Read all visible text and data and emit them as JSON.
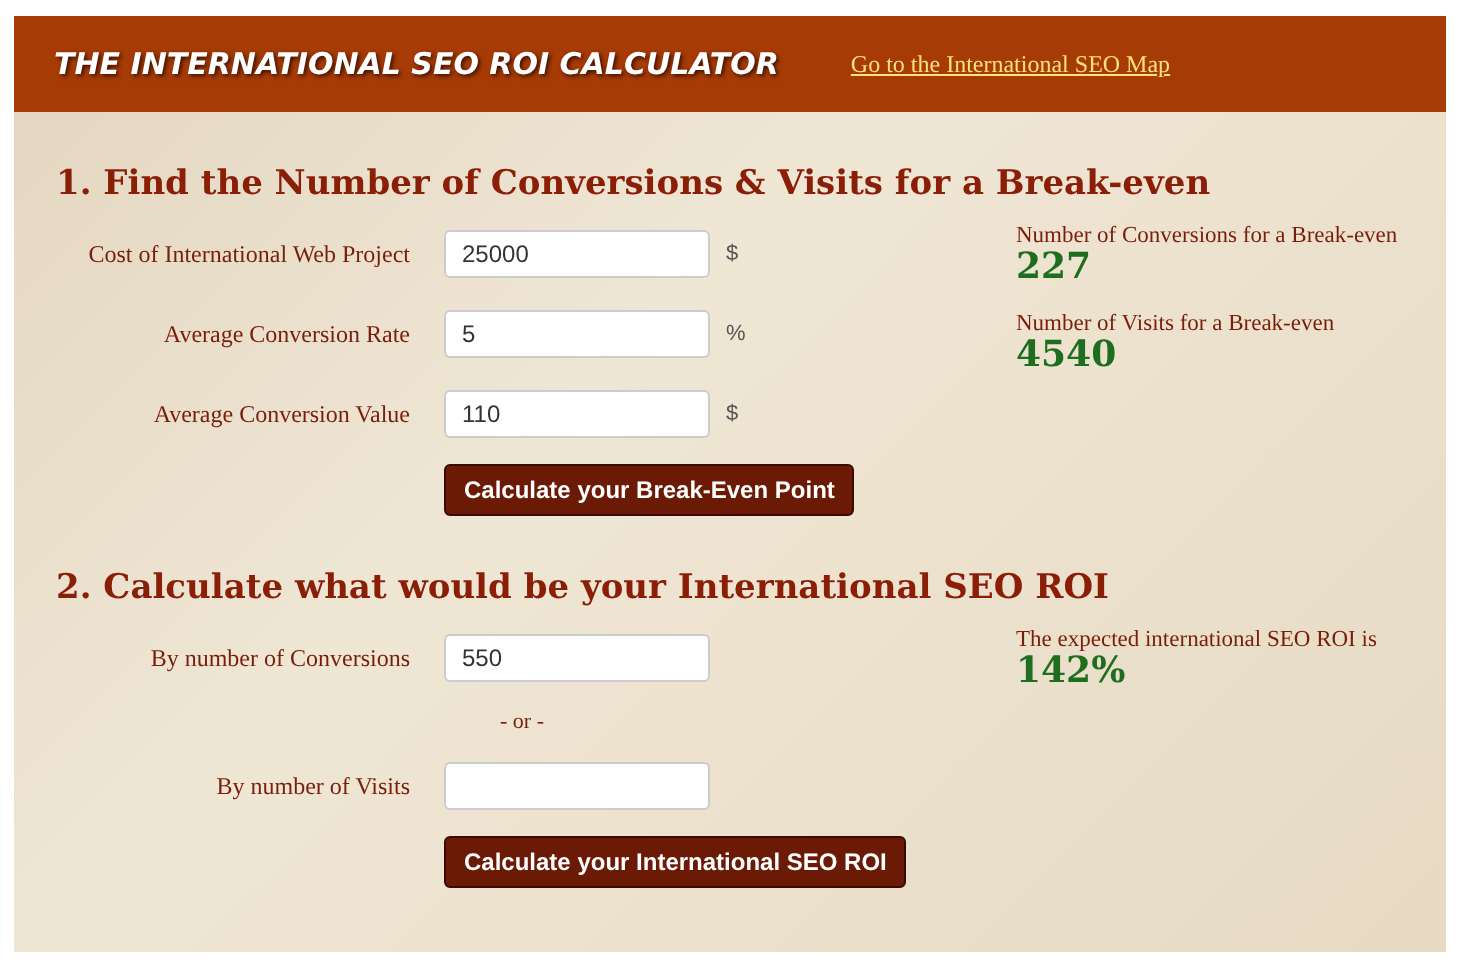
{
  "header": {
    "title": "THE INTERNATIONAL SEO ROI CALCULATOR",
    "link": "Go to the International SEO Map"
  },
  "sections": [
    {
      "heading": "1. Find the Number of Conversions & Visits for a Break-even",
      "rows": [
        {
          "kind": "field",
          "label": "Cost of International Web Project",
          "value": "25000",
          "unit": "$"
        },
        {
          "kind": "field",
          "label": "Average Conversion Rate",
          "value": "5",
          "unit": "%"
        },
        {
          "kind": "field",
          "label": "Average Conversion Value",
          "value": "110",
          "unit": "$"
        }
      ],
      "button": "Calculate your Break-Even Point",
      "results": [
        {
          "label": "Number of Conversions for a Break-even",
          "value": "227"
        },
        {
          "label": "Number of Visits for a Break-even",
          "value": "4540"
        }
      ]
    },
    {
      "heading": "2. Calculate what would be your International SEO ROI",
      "rows": [
        {
          "kind": "field",
          "label": "By number of Conversions",
          "value": "550"
        },
        {
          "kind": "separator",
          "label": "- or -"
        },
        {
          "kind": "field",
          "label": "By number of Visits",
          "value": ""
        }
      ],
      "button": "Calculate your International SEO ROI",
      "results": [
        {
          "label": "The expected international SEO ROI is",
          "value": "142%"
        }
      ]
    }
  ]
}
